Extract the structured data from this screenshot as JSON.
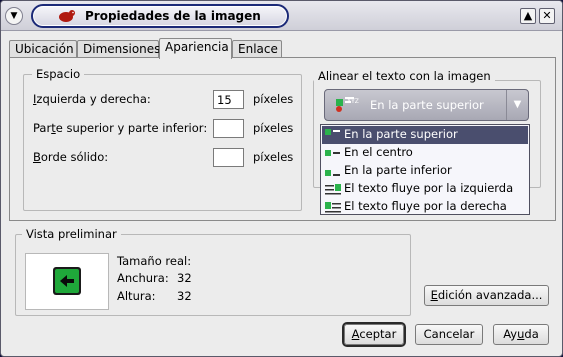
{
  "window": {
    "title": "Propiedades de la imagen",
    "menu_glyph": "▼",
    "minimize_glyph": "▲",
    "close_glyph": "✕"
  },
  "tabs": [
    {
      "label": "Ubicación",
      "active": false
    },
    {
      "label": "Dimensiones",
      "active": false
    },
    {
      "label": "Apariencia",
      "active": true
    },
    {
      "label": "Enlace",
      "active": false
    }
  ],
  "spacing": {
    "title": "Espacio",
    "rows": [
      {
        "label_first": "I",
        "label_rest": "zquierda y derecha:",
        "value": "15",
        "unit": "píxeles"
      },
      {
        "label_pre": "Par",
        "label_u": "t",
        "label_post": "e superior y parte inferior:",
        "value": "",
        "unit": "píxeles"
      },
      {
        "label_first": "B",
        "label_rest": "orde sólido:",
        "value": "",
        "unit": "píxeles"
      }
    ]
  },
  "align": {
    "title": "Alinear el texto con la imagen",
    "selected": "En la parte superior",
    "options": [
      {
        "label": "En la parte superior",
        "icon": "align-top-icon",
        "selected": true
      },
      {
        "label": "En el centro",
        "icon": "align-center-icon",
        "selected": false
      },
      {
        "label": "En la parte inferior",
        "icon": "align-bottom-icon",
        "selected": false
      },
      {
        "label": "El texto fluye por la izquierda",
        "icon": "wrap-left-icon",
        "selected": false
      },
      {
        "label": "El texto fluye por la derecha",
        "icon": "wrap-right-icon",
        "selected": false
      }
    ]
  },
  "preview": {
    "title": "Vista preliminar",
    "real_size_label": "Tamaño real:",
    "width_label": "Anchura:",
    "width_value": "32",
    "height_label": "Altura:",
    "height_value": "32"
  },
  "buttons": {
    "advanced_pre": "E",
    "advanced_rest": "dición avanzada...",
    "accept_pre": "A",
    "accept_rest": "ceptar",
    "cancel": "Cancelar",
    "help_pre": "Ay",
    "help_u": "u",
    "help_post": "da"
  },
  "colors": {
    "accent": "#1c2a78",
    "selection": "#4a4e6e",
    "preview_icon_green": "#1fa83a"
  }
}
